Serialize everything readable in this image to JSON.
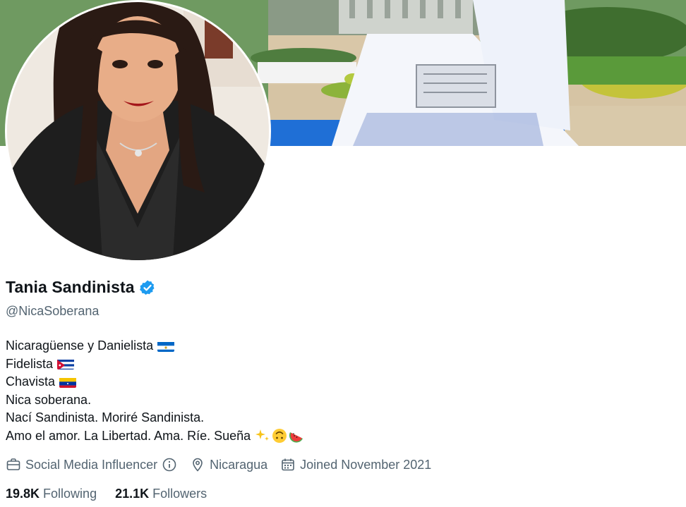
{
  "profile": {
    "display_name": "Tania Sandinista",
    "handle": "@NicaSoberana",
    "verified_icon": "verified-badge-icon",
    "accent_color": "#1d9bf0"
  },
  "bio": {
    "lines": [
      {
        "text": "Nicaragüense y Danielista",
        "flag": "flag-nicaragua"
      },
      {
        "text": "Fidelista",
        "flag": "flag-cuba"
      },
      {
        "text": "Chavista",
        "flag": "flag-venezuela"
      },
      {
        "text": "Nica soberana.",
        "flag": ""
      },
      {
        "text": "Nací Sandinista. Moriré Sandinista.",
        "flag": ""
      },
      {
        "text": "Amo el amor. La Libertad. Ama. Ríe. Sueña",
        "emojis": [
          "sparkles-emoji",
          "upside-down-face-emoji",
          "watermelon-emoji"
        ]
      }
    ]
  },
  "meta": {
    "category": "Social Media Influencer",
    "location": "Nicaragua",
    "joined": "Joined November 2021"
  },
  "stats": {
    "following_count": "19.8K",
    "following_label": "Following",
    "followers_count": "21.1K",
    "followers_label": "Followers"
  }
}
